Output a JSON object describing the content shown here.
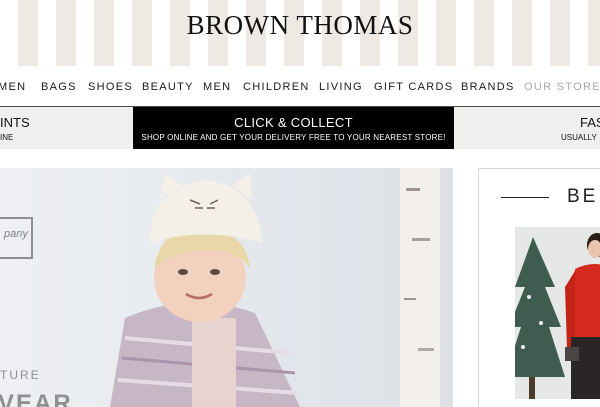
{
  "brand": {
    "logo_text": "BROWN THOMAS"
  },
  "nav": {
    "items": [
      {
        "label": "MEN"
      },
      {
        "label": "BAGS"
      },
      {
        "label": "SHOES"
      },
      {
        "label": "BEAUTY"
      },
      {
        "label": "MEN"
      },
      {
        "label": "CHILDREN"
      },
      {
        "label": "LIVING"
      },
      {
        "label": "GIFT CARDS"
      },
      {
        "label": "BRANDS"
      },
      {
        "label": "OUR STORES"
      }
    ]
  },
  "promo": {
    "left": {
      "title": "INTS",
      "subtitle": "INE"
    },
    "center": {
      "title": "CLICK & COLLECT",
      "subtitle": "SHOP ONLINE AND GET YOUR DELIVERY FREE TO YOUR NEAREST STORE!"
    },
    "right": {
      "title": "FAS",
      "subtitle": "USUALLY"
    }
  },
  "hero": {
    "logo_fragment": "pany",
    "caption_line1": "TURE",
    "caption_line2": "VEAR"
  },
  "right_panel": {
    "heading": "BE"
  },
  "colors": {
    "stripe": "#efe9e4",
    "promo_center_bg": "#000000",
    "nav_muted": "#a9a9a9"
  }
}
